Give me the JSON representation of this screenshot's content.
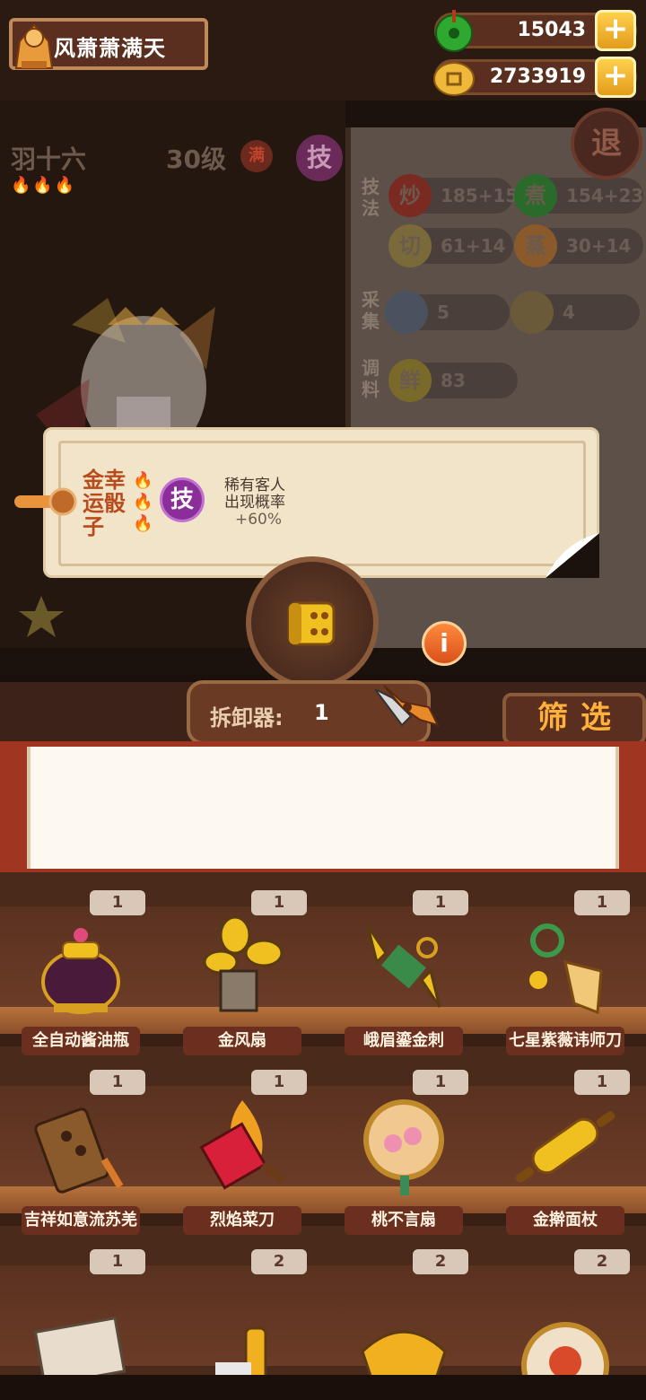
{
  "player": {
    "name": "风萧萧满天"
  },
  "currency": {
    "jade": "15043",
    "coins": "2733919",
    "plus": "+"
  },
  "character": {
    "name": "羽十六",
    "level": "30级",
    "full_badge": "满",
    "skill_badge": "技",
    "flames": "🔥🔥🔥"
  },
  "stats": {
    "technique_label": "技法",
    "gather_label": "采集",
    "seasoning_label": "调料",
    "stir_fry": {
      "icon": "炒",
      "value": "185+15"
    },
    "boil": {
      "icon": "煮",
      "value": "154+23"
    },
    "cut": {
      "icon": "切",
      "value": "61+14"
    },
    "steam": {
      "icon": "蒸",
      "value": "30+14"
    },
    "meat": {
      "value": "5"
    },
    "grain": {
      "value": "4"
    },
    "fresh": {
      "icon": "鲜",
      "value": "83"
    }
  },
  "retreat_label": "退",
  "tooltip": {
    "title": "金幸运骰子",
    "flames": "🔥🔥🔥",
    "skill_badge": "技",
    "desc_line1": "稀有客人",
    "desc_line2": "出现概率",
    "desc_value": "+60%"
  },
  "info_label": "i",
  "disassembler": {
    "label": "拆卸器:",
    "count": "1"
  },
  "filter_label": "筛选",
  "inventory": [
    {
      "count": "1",
      "name": "全自动酱油瓶"
    },
    {
      "count": "1",
      "name": "金风扇"
    },
    {
      "count": "1",
      "name": "峨眉鎏金刺"
    },
    {
      "count": "1",
      "name": "七星紫薇讳师刀"
    },
    {
      "count": "1",
      "name": "吉祥如意流苏羌"
    },
    {
      "count": "1",
      "name": "烈焰菜刀"
    },
    {
      "count": "1",
      "name": "桃不言扇"
    },
    {
      "count": "1",
      "name": "金擀面杖"
    },
    {
      "count": "1",
      "name": ""
    },
    {
      "count": "2",
      "name": ""
    },
    {
      "count": "2",
      "name": ""
    },
    {
      "count": "2",
      "name": ""
    }
  ],
  "colors": {
    "accent": "#ffb13b",
    "panel_bg": "#f2e4c9",
    "shelf": "#b8733c"
  }
}
